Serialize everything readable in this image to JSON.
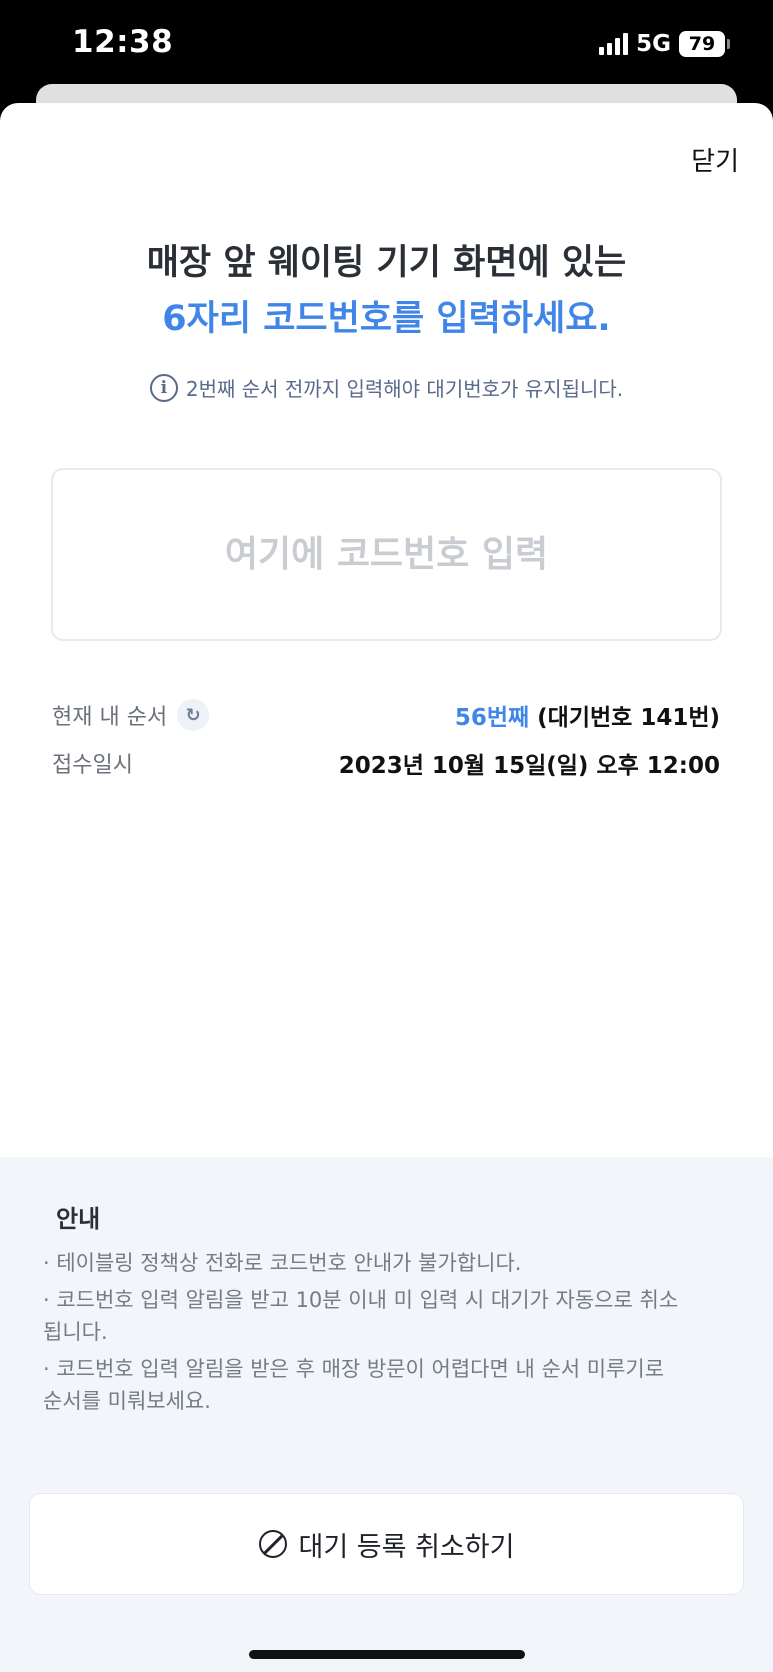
{
  "status": {
    "time": "12:38",
    "network": "5G",
    "battery": "79"
  },
  "header": {
    "close_label": "닫기"
  },
  "title": {
    "line1": "매장 앞 웨이팅 기기 화면에 있는",
    "line2": "6자리 코드번호를 입력하세요."
  },
  "notice": {
    "icon": "info-icon",
    "text": "2번째 순서 전까지 입력해야 대기번호가 유지됩니다."
  },
  "code_input": {
    "placeholder": "여기에 코드번호 입력",
    "value": ""
  },
  "details": {
    "order_label": "현재 내 순서",
    "order_value": "56번째",
    "waiting_number": "(대기번호 141번)",
    "received_label": "접수일시",
    "received_value": "2023년 10월 15일(일) 오후 12:00"
  },
  "guide": {
    "title": "안내",
    "items": [
      "· 테이블링 정책상 전화로 코드번호 안내가 불가합니다.",
      "· 코드번호 입력 알림을 받고 10분 이내 미 입력 시  대기가 자동으로 취소됩니다.",
      "· 코드번호 입력 알림을 받은 후 매장 방문이 어렵다면 내 순서 미루기로 순서를 미뤄보세요."
    ]
  },
  "cancel_button": {
    "label": "대기 등록 취소하기"
  },
  "colors": {
    "accent": "#3f86e8",
    "guide_background": "#f2f5fa"
  }
}
